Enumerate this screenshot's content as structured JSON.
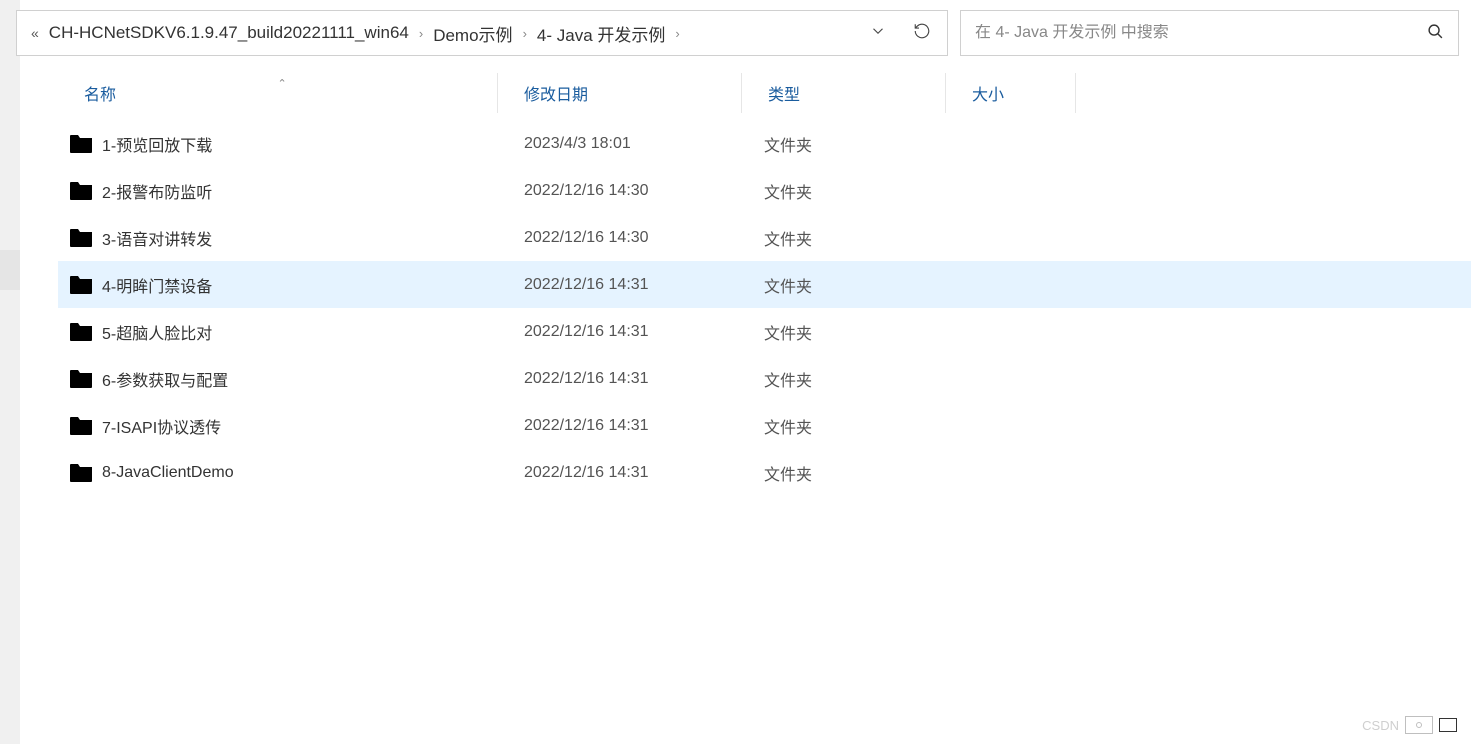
{
  "breadcrumb": {
    "segments": [
      "CH-HCNetSDKV6.1.9.47_build20221111_win64",
      "Demo示例",
      "4- Java 开发示例"
    ]
  },
  "search": {
    "placeholder": "在 4- Java 开发示例 中搜索"
  },
  "headers": {
    "name": "名称",
    "date": "修改日期",
    "type": "类型",
    "size": "大小"
  },
  "rows": [
    {
      "name": "1-预览回放下载",
      "date": "2023/4/3 18:01",
      "type": "文件夹",
      "size": "",
      "selected": false
    },
    {
      "name": "2-报警布防监听",
      "date": "2022/12/16 14:30",
      "type": "文件夹",
      "size": "",
      "selected": false
    },
    {
      "name": "3-语音对讲转发",
      "date": "2022/12/16 14:30",
      "type": "文件夹",
      "size": "",
      "selected": false
    },
    {
      "name": "4-明眸门禁设备",
      "date": "2022/12/16 14:31",
      "type": "文件夹",
      "size": "",
      "selected": true
    },
    {
      "name": "5-超脑人脸比对",
      "date": "2022/12/16 14:31",
      "type": "文件夹",
      "size": "",
      "selected": false
    },
    {
      "name": "6-参数获取与配置",
      "date": "2022/12/16 14:31",
      "type": "文件夹",
      "size": "",
      "selected": false
    },
    {
      "name": "7-ISAPI协议透传",
      "date": "2022/12/16 14:31",
      "type": "文件夹",
      "size": "",
      "selected": false
    },
    {
      "name": "8-JavaClientDemo",
      "date": "2022/12/16 14:31",
      "type": "文件夹",
      "size": "",
      "selected": false
    }
  ],
  "watermark": "CSDN"
}
